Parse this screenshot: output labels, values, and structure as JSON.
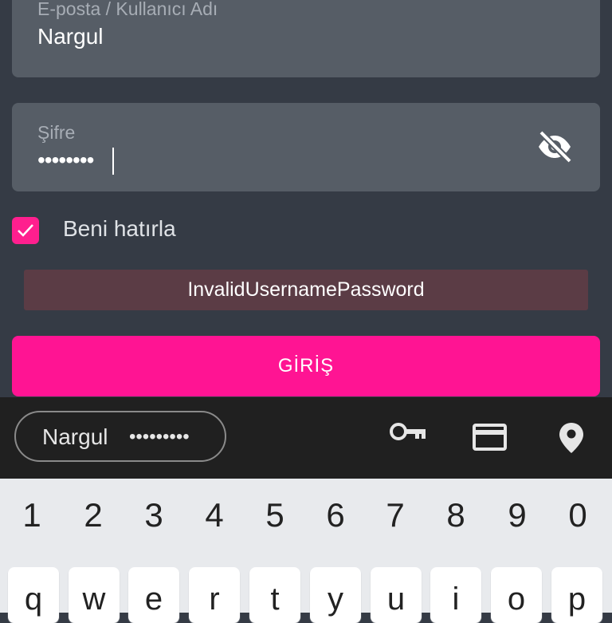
{
  "form": {
    "email_label": "E-posta / Kullanıcı Adı",
    "email_value": "Nargul",
    "password_label": "Şifre",
    "password_value": "••••••••",
    "remember_label": "Beni hatırla",
    "remember_checked": true,
    "error_text": "InvalidUsernamePassword",
    "login_label": "GİRİŞ"
  },
  "autofill": {
    "chip_username": "Nargul",
    "chip_password": "•••••••••",
    "icons": [
      "key-icon",
      "credit-card-icon",
      "location-pin-icon"
    ]
  },
  "keyboard": {
    "number_row": [
      "1",
      "2",
      "3",
      "4",
      "5",
      "6",
      "7",
      "8",
      "9",
      "0"
    ],
    "letter_row": [
      "q",
      "w",
      "e",
      "r",
      "t",
      "y",
      "u",
      "i",
      "o",
      "p"
    ]
  },
  "colors": {
    "background": "#353b45",
    "field": "#565d66",
    "accent": "#ff1493",
    "error_bg": "#5b3c45",
    "autofill_bar": "#202020",
    "keyboard_bg": "#e8eaed"
  }
}
